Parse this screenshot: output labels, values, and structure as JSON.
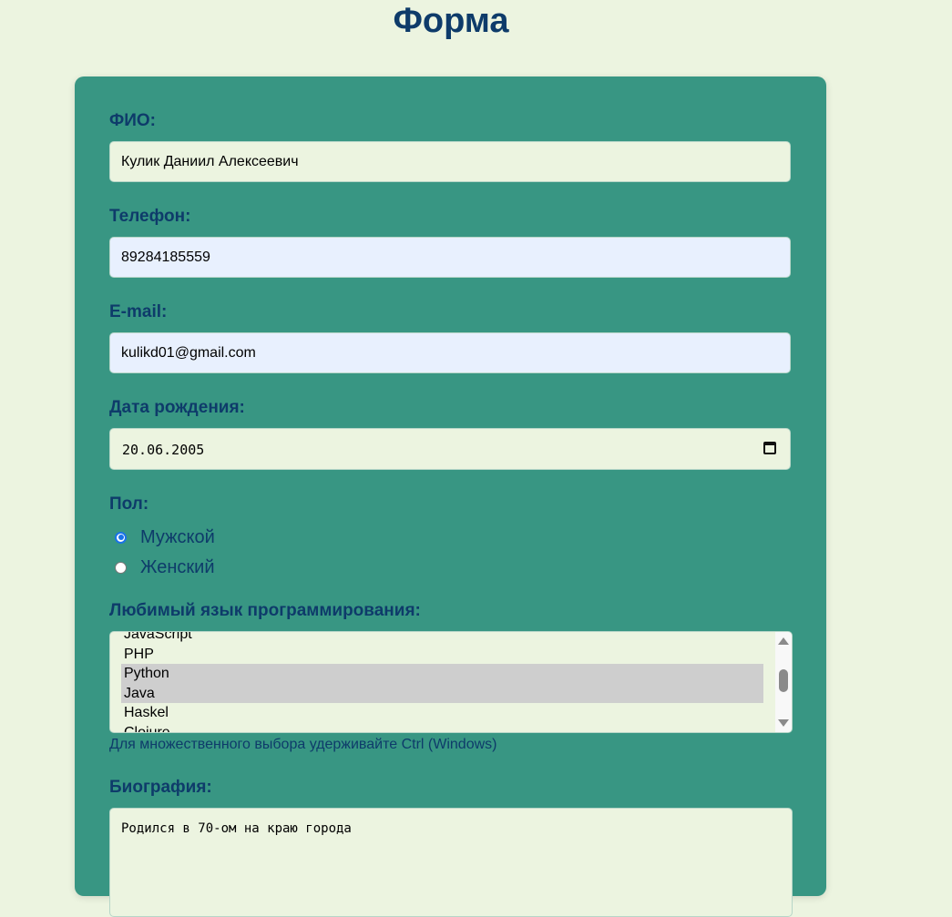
{
  "page": {
    "title": "Форма"
  },
  "form": {
    "fio": {
      "label": "ФИО:",
      "value": "Кулик Даниил Алексеевич"
    },
    "phone": {
      "label": "Телефон:",
      "value": "89284185559"
    },
    "email": {
      "label": "E-mail:",
      "value": "kulikd01@gmail.com"
    },
    "birthdate": {
      "label": "Дата рождения:",
      "value": "20.06.2005"
    },
    "gender": {
      "label": "Пол:",
      "options": [
        {
          "label": "Мужской",
          "checked": true
        },
        {
          "label": "Женский",
          "checked": false
        }
      ]
    },
    "language": {
      "label": "Любимый язык программирования:",
      "options": [
        {
          "label": "JavaScript",
          "selected": false
        },
        {
          "label": "PHP",
          "selected": false
        },
        {
          "label": "Python",
          "selected": true
        },
        {
          "label": "Java",
          "selected": true
        },
        {
          "label": "Haskel",
          "selected": false
        },
        {
          "label": "Clojure",
          "selected": false
        }
      ],
      "hint": "Для множественного выбора удерживайте Ctrl (Windows)"
    },
    "bio": {
      "label": "Биография:",
      "value": "Родился в 70-ом на краю города"
    }
  },
  "colors": {
    "page_background": "#ecf4e0",
    "card_background": "#389683",
    "label_color": "#0e3b6a",
    "autofill_background": "#e8f0fe",
    "radio_accent": "#1a73e8",
    "selected_option": "#cecece"
  }
}
